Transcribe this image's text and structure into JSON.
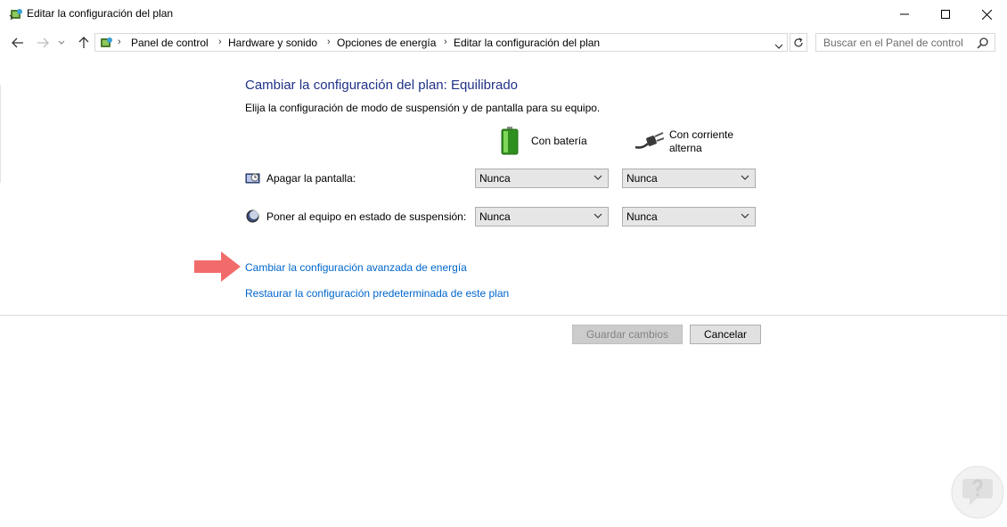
{
  "window": {
    "title": "Editar la configuración del plan",
    "icon": "power-options-icon"
  },
  "address": {
    "breadcrumbs": [
      "Panel de control",
      "Hardware y sonido",
      "Opciones de energía",
      "Editar la configuración del plan"
    ],
    "search_placeholder": "Buscar en el Panel de control"
  },
  "main": {
    "heading": "Cambiar la configuración del plan: Equilibrado",
    "subheading": "Elija la configuración de modo de suspensión y de pantalla para su equipo.",
    "columns": {
      "battery": "Con batería",
      "ac_line1": "Con corriente",
      "ac_line2": "alterna"
    },
    "rows": [
      {
        "label": "Apagar la pantalla:",
        "battery_value": "Nunca",
        "ac_value": "Nunca",
        "icon": "display-off-icon"
      },
      {
        "label": "Poner al equipo en estado de suspensión:",
        "battery_value": "Nunca",
        "ac_value": "Nunca",
        "icon": "sleep-moon-icon"
      }
    ],
    "links": {
      "advanced": "Cambiar la configuración avanzada de energía",
      "restore": "Restaurar la configuración predeterminada de este plan"
    },
    "buttons": {
      "save": "Guardar cambios",
      "cancel": "Cancelar"
    }
  },
  "colors": {
    "heading": "#1e3287",
    "link": "#0066cc",
    "arrow": "#f26b6b"
  }
}
